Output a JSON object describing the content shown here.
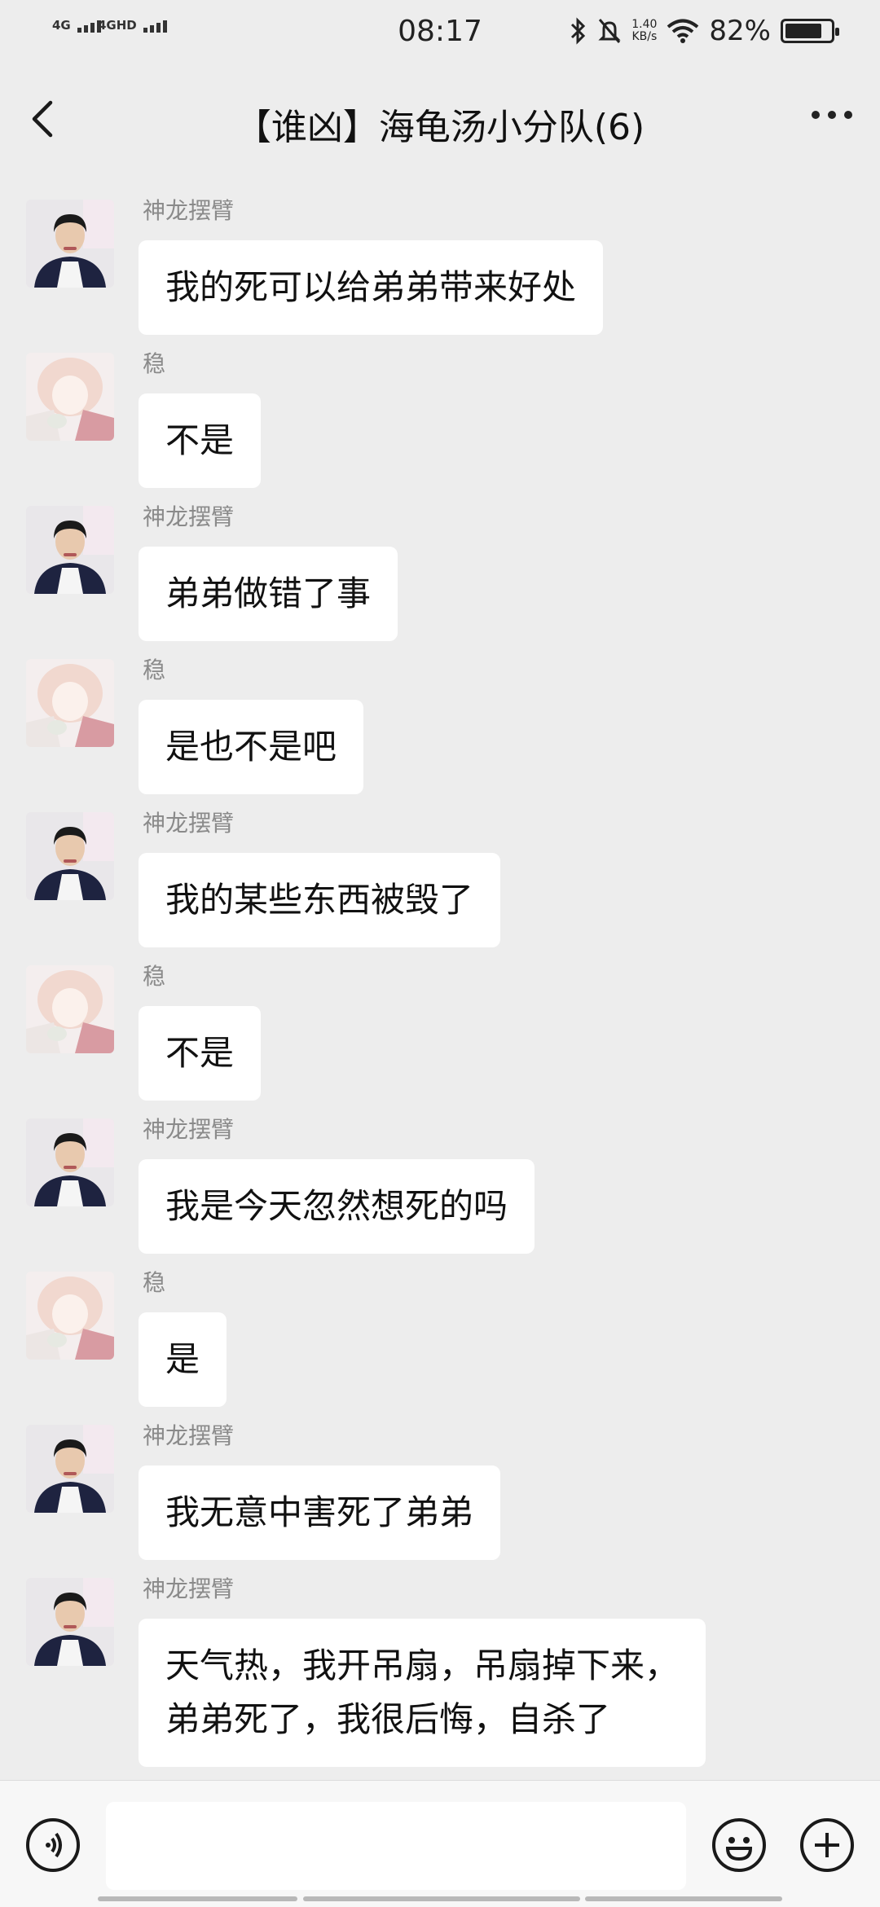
{
  "status_bar": {
    "signal1": "4G",
    "signal2": "4GHD",
    "time": "08:17",
    "net_speed_value": "1.40",
    "net_speed_unit": "KB/s",
    "battery_percent_text": "82%",
    "battery_level": 0.82
  },
  "header": {
    "title": "【谁凶】海龟汤小分队(6)",
    "back_icon": "chevron-left-icon",
    "more_icon": "more-dots-icon"
  },
  "messages": [
    {
      "sender": "神龙摆臂",
      "avatar": "avatar-man",
      "text": "我的死可以给弟弟带来好处"
    },
    {
      "sender": "稳",
      "avatar": "avatar-anime",
      "text": "不是"
    },
    {
      "sender": "神龙摆臂",
      "avatar": "avatar-man",
      "text": "弟弟做错了事"
    },
    {
      "sender": "稳",
      "avatar": "avatar-anime",
      "text": "是也不是吧"
    },
    {
      "sender": "神龙摆臂",
      "avatar": "avatar-man",
      "text": "我的某些东西被毁了"
    },
    {
      "sender": "稳",
      "avatar": "avatar-anime",
      "text": "不是"
    },
    {
      "sender": "神龙摆臂",
      "avatar": "avatar-man",
      "text": "我是今天忽然想死的吗"
    },
    {
      "sender": "稳",
      "avatar": "avatar-anime",
      "text": "是"
    },
    {
      "sender": "神龙摆臂",
      "avatar": "avatar-man",
      "text": "我无意中害死了弟弟"
    },
    {
      "sender": "神龙摆臂",
      "avatar": "avatar-man",
      "text": "天气热，我开吊扇，吊扇掉下来，\n弟弟死了，我很后悔，自杀了"
    }
  ],
  "input_bar": {
    "voice_icon": "voice-icon",
    "input_placeholder": "",
    "emoji_icon": "emoji-icon",
    "plus_icon": "plus-icon"
  },
  "colors": {
    "background": "#ededed",
    "bubble": "#ffffff",
    "sender_name": "#8a8a8a"
  }
}
